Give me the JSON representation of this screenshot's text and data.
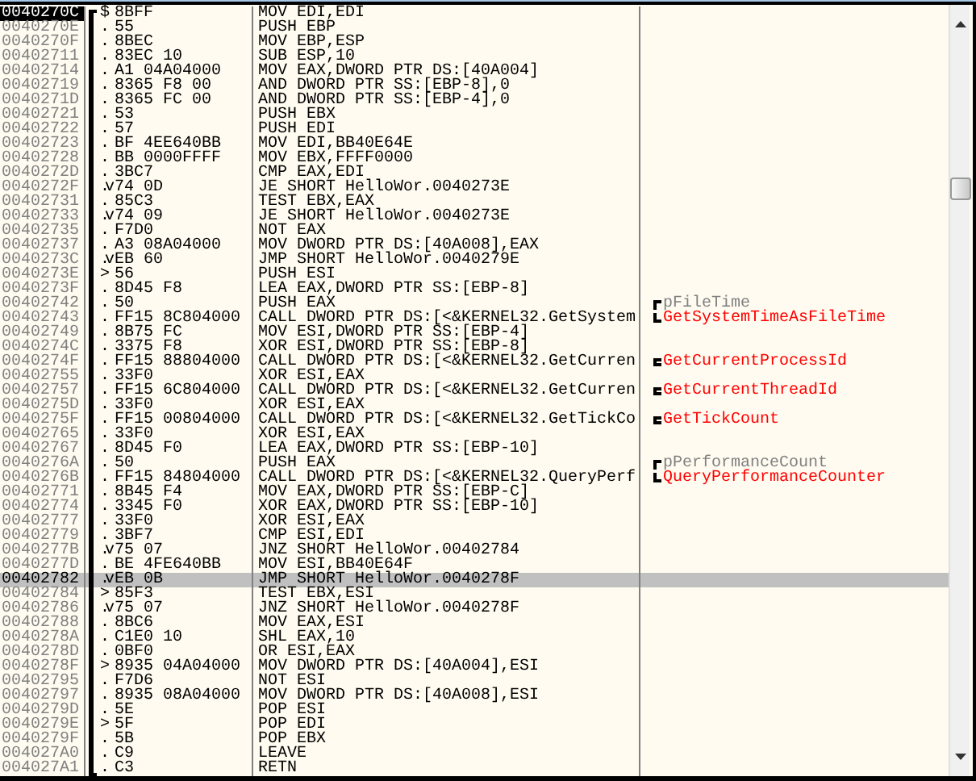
{
  "rows": [
    {
      "address": "0040270C",
      "marker": "$",
      "hex": "8BFF",
      "instruction": "MOV EDI,EDI",
      "current": true,
      "selected": false
    },
    {
      "address": "0040270E",
      "marker": ".",
      "hex": "55",
      "instruction": "PUSH EBP",
      "current": false,
      "selected": false
    },
    {
      "address": "0040270F",
      "marker": ".",
      "hex": "8BEC",
      "instruction": "MOV EBP,ESP",
      "current": false,
      "selected": false
    },
    {
      "address": "00402711",
      "marker": ".",
      "hex": "83EC 10",
      "instruction": "SUB ESP,10",
      "current": false,
      "selected": false
    },
    {
      "address": "00402714",
      "marker": ".",
      "hex": "A1 04A04000",
      "instruction": "MOV EAX,DWORD PTR DS:[40A004]",
      "current": false,
      "selected": false
    },
    {
      "address": "00402719",
      "marker": ".",
      "hex": "8365 F8 00",
      "instruction": "AND DWORD PTR SS:[EBP-8],0",
      "current": false,
      "selected": false
    },
    {
      "address": "0040271D",
      "marker": ".",
      "hex": "8365 FC 00",
      "instruction": "AND DWORD PTR SS:[EBP-4],0",
      "current": false,
      "selected": false
    },
    {
      "address": "00402721",
      "marker": ".",
      "hex": "53",
      "instruction": "PUSH EBX",
      "current": false,
      "selected": false
    },
    {
      "address": "00402722",
      "marker": ".",
      "hex": "57",
      "instruction": "PUSH EDI",
      "current": false,
      "selected": false
    },
    {
      "address": "00402723",
      "marker": ".",
      "hex": "BF 4EE640BB",
      "instruction": "MOV EDI,BB40E64E",
      "current": false,
      "selected": false
    },
    {
      "address": "00402728",
      "marker": ".",
      "hex": "BB 0000FFFF",
      "instruction": "MOV EBX,FFFF0000",
      "current": false,
      "selected": false
    },
    {
      "address": "0040272D",
      "marker": ".",
      "hex": "3BC7",
      "instruction": "CMP EAX,EDI",
      "current": false,
      "selected": false
    },
    {
      "address": "0040272F",
      "marker": ".v",
      "hex": "74 0D",
      "instruction": "JE SHORT HelloWor.0040273E",
      "current": false,
      "selected": false
    },
    {
      "address": "00402731",
      "marker": ".",
      "hex": "85C3",
      "instruction": "TEST EBX,EAX",
      "current": false,
      "selected": false
    },
    {
      "address": "00402733",
      "marker": ".v",
      "hex": "74 09",
      "instruction": "JE SHORT HelloWor.0040273E",
      "current": false,
      "selected": false
    },
    {
      "address": "00402735",
      "marker": ".",
      "hex": "F7D0",
      "instruction": "NOT EAX",
      "current": false,
      "selected": false
    },
    {
      "address": "00402737",
      "marker": ".",
      "hex": "A3 08A04000",
      "instruction": "MOV DWORD PTR DS:[40A008],EAX",
      "current": false,
      "selected": false
    },
    {
      "address": "0040273C",
      "marker": ".v",
      "hex": "EB 60",
      "instruction": "JMP SHORT HelloWor.0040279E",
      "current": false,
      "selected": false
    },
    {
      "address": "0040273E",
      "marker": ">",
      "hex": "56",
      "instruction": "PUSH ESI",
      "current": false,
      "selected": false
    },
    {
      "address": "0040273F",
      "marker": ".",
      "hex": "8D45 F8",
      "instruction": "LEA EAX,DWORD PTR SS:[EBP-8]",
      "current": false,
      "selected": false
    },
    {
      "address": "00402742",
      "marker": ".",
      "hex": "50",
      "instruction": "PUSH EAX",
      "current": false,
      "selected": false,
      "comment": {
        "text": "pFileTime",
        "kind": "argument"
      }
    },
    {
      "address": "00402743",
      "marker": ".",
      "hex": "FF15 8C804000",
      "instruction": "CALL DWORD PTR DS:[<&KERNEL32.GetSystem",
      "current": false,
      "selected": false,
      "comment": {
        "text": "GetSystemTimeAsFileTime",
        "kind": "api"
      }
    },
    {
      "address": "00402749",
      "marker": ".",
      "hex": "8B75 FC",
      "instruction": "MOV ESI,DWORD PTR SS:[EBP-4]",
      "current": false,
      "selected": false
    },
    {
      "address": "0040274C",
      "marker": ".",
      "hex": "3375 F8",
      "instruction": "XOR ESI,DWORD PTR SS:[EBP-8]",
      "current": false,
      "selected": false
    },
    {
      "address": "0040274F",
      "marker": ".",
      "hex": "FF15 88804000",
      "instruction": "CALL DWORD PTR DS:[<&KERNEL32.GetCurren",
      "current": false,
      "selected": false,
      "comment": {
        "text": "GetCurrentProcessId",
        "kind": "api"
      }
    },
    {
      "address": "00402755",
      "marker": ".",
      "hex": "33F0",
      "instruction": "XOR ESI,EAX",
      "current": false,
      "selected": false
    },
    {
      "address": "00402757",
      "marker": ".",
      "hex": "FF15 6C804000",
      "instruction": "CALL DWORD PTR DS:[<&KERNEL32.GetCurren",
      "current": false,
      "selected": false,
      "comment": {
        "text": "GetCurrentThreadId",
        "kind": "api"
      }
    },
    {
      "address": "0040275D",
      "marker": ".",
      "hex": "33F0",
      "instruction": "XOR ESI,EAX",
      "current": false,
      "selected": false
    },
    {
      "address": "0040275F",
      "marker": ".",
      "hex": "FF15 00804000",
      "instruction": "CALL DWORD PTR DS:[<&KERNEL32.GetTickCo",
      "current": false,
      "selected": false,
      "comment": {
        "text": "GetTickCount",
        "kind": "api"
      }
    },
    {
      "address": "00402765",
      "marker": ".",
      "hex": "33F0",
      "instruction": "XOR ESI,EAX",
      "current": false,
      "selected": false
    },
    {
      "address": "00402767",
      "marker": ".",
      "hex": "8D45 F0",
      "instruction": "LEA EAX,DWORD PTR SS:[EBP-10]",
      "current": false,
      "selected": false
    },
    {
      "address": "0040276A",
      "marker": ".",
      "hex": "50",
      "instruction": "PUSH EAX",
      "current": false,
      "selected": false,
      "comment": {
        "text": "pPerformanceCount",
        "kind": "argument"
      }
    },
    {
      "address": "0040276B",
      "marker": ".",
      "hex": "FF15 84804000",
      "instruction": "CALL DWORD PTR DS:[<&KERNEL32.QueryPerf",
      "current": false,
      "selected": false,
      "comment": {
        "text": "QueryPerformanceCounter",
        "kind": "api"
      }
    },
    {
      "address": "00402771",
      "marker": ".",
      "hex": "8B45 F4",
      "instruction": "MOV EAX,DWORD PTR SS:[EBP-C]",
      "current": false,
      "selected": false
    },
    {
      "address": "00402774",
      "marker": ".",
      "hex": "3345 F0",
      "instruction": "XOR EAX,DWORD PTR SS:[EBP-10]",
      "current": false,
      "selected": false
    },
    {
      "address": "00402777",
      "marker": ".",
      "hex": "33F0",
      "instruction": "XOR ESI,EAX",
      "current": false,
      "selected": false
    },
    {
      "address": "00402779",
      "marker": ".",
      "hex": "3BF7",
      "instruction": "CMP ESI,EDI",
      "current": false,
      "selected": false
    },
    {
      "address": "0040277B",
      "marker": ".v",
      "hex": "75 07",
      "instruction": "JNZ SHORT HelloWor.00402784",
      "current": false,
      "selected": false
    },
    {
      "address": "0040277D",
      "marker": ".",
      "hex": "BE 4FE640BB",
      "instruction": "MOV ESI,BB40E64F",
      "current": false,
      "selected": false
    },
    {
      "address": "00402782",
      "marker": ".v",
      "hex": "EB 0B",
      "instruction": "JMP SHORT HelloWor.0040278F",
      "current": false,
      "selected": true
    },
    {
      "address": "00402784",
      "marker": ">",
      "hex": "85F3",
      "instruction": "TEST EBX,ESI",
      "current": false,
      "selected": false
    },
    {
      "address": "00402786",
      "marker": ".v",
      "hex": "75 07",
      "instruction": "JNZ SHORT HelloWor.0040278F",
      "current": false,
      "selected": false
    },
    {
      "address": "00402788",
      "marker": ".",
      "hex": "8BC6",
      "instruction": "MOV EAX,ESI",
      "current": false,
      "selected": false
    },
    {
      "address": "0040278A",
      "marker": ".",
      "hex": "C1E0 10",
      "instruction": "SHL EAX,10",
      "current": false,
      "selected": false
    },
    {
      "address": "0040278D",
      "marker": ".",
      "hex": "0BF0",
      "instruction": "OR ESI,EAX",
      "current": false,
      "selected": false
    },
    {
      "address": "0040278F",
      "marker": ">",
      "hex": "8935 04A04000",
      "instruction": "MOV DWORD PTR DS:[40A004],ESI",
      "current": false,
      "selected": false
    },
    {
      "address": "00402795",
      "marker": ".",
      "hex": "F7D6",
      "instruction": "NOT ESI",
      "current": false,
      "selected": false
    },
    {
      "address": "00402797",
      "marker": ".",
      "hex": "8935 08A04000",
      "instruction": "MOV DWORD PTR DS:[40A008],ESI",
      "current": false,
      "selected": false
    },
    {
      "address": "0040279D",
      "marker": ".",
      "hex": "5E",
      "instruction": "POP ESI",
      "current": false,
      "selected": false
    },
    {
      "address": "0040279E",
      "marker": ">",
      "hex": "5F",
      "instruction": "POP EDI",
      "current": false,
      "selected": false
    },
    {
      "address": "0040279F",
      "marker": ".",
      "hex": "5B",
      "instruction": "POP EBX",
      "current": false,
      "selected": false
    },
    {
      "address": "004027A0",
      "marker": ".",
      "hex": "C9",
      "instruction": "LEAVE",
      "current": false,
      "selected": false
    },
    {
      "address": "004027A1",
      "marker": ".",
      "hex": "C3",
      "instruction": "RETN",
      "current": false,
      "selected": false
    }
  ]
}
